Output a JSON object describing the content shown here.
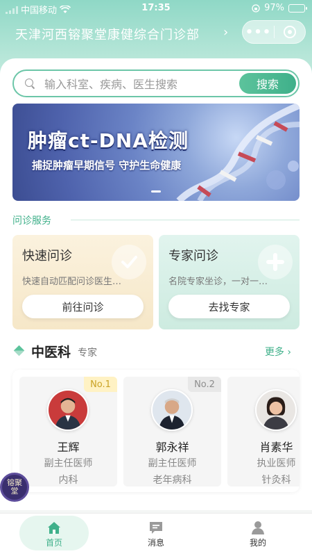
{
  "status_bar": {
    "carrier": "中国移动",
    "time": "17:35",
    "battery": "97%",
    "battery_level": 0.97
  },
  "header": {
    "title": "天津河西镕聚堂康健综合门诊部",
    "chevron": "›"
  },
  "search": {
    "placeholder": "输入科室、疾病、医生搜索",
    "button": "搜索"
  },
  "banner": {
    "title": "肿瘤ct-DNA检测",
    "subtitle": "捕捉肿瘤早期信号 守护生命健康"
  },
  "services": {
    "title": "问诊服务",
    "quick": {
      "name": "快速问诊",
      "desc": "快速自动匹配问诊医生…",
      "button": "前往问诊"
    },
    "expert": {
      "name": "专家问诊",
      "desc": "名院专家坐诊，一对一…",
      "button": "去找专家"
    }
  },
  "department": {
    "name": "中医科",
    "sub": "专家",
    "more": "更多 ›"
  },
  "doctors": [
    {
      "rank": "No.1",
      "name": "王辉",
      "title": "副主任医师",
      "dept": "内科"
    },
    {
      "rank": "No.2",
      "name": "郭永祥",
      "title": "副主任医师",
      "dept": "老年病科"
    },
    {
      "rank": "",
      "name": "肖素华",
      "title": "执业医师",
      "dept": "针灸科"
    }
  ],
  "seal": {
    "text": "镕聚堂"
  },
  "tabbar": [
    {
      "label": "首页",
      "icon": "home-icon",
      "active": true
    },
    {
      "label": "消息",
      "icon": "message-icon",
      "active": false
    },
    {
      "label": "我的",
      "icon": "profile-icon",
      "active": false
    }
  ],
  "colors": {
    "accent": "#3fb08a",
    "header_gradient": "#8fd8c6",
    "rank1": "#c9a225"
  }
}
